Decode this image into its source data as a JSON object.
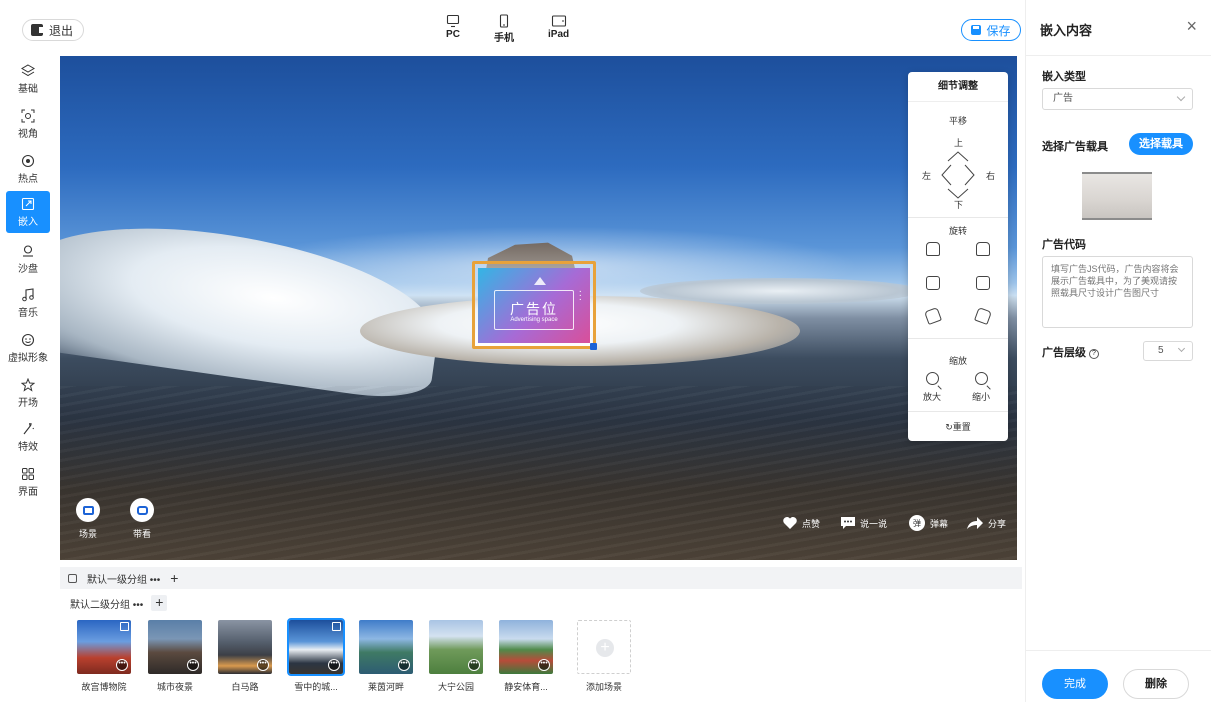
{
  "topbar": {
    "exit_label": "退出",
    "devices": [
      {
        "label": "PC",
        "icon": "monitor-icon"
      },
      {
        "label": "手机",
        "icon": "phone-icon"
      },
      {
        "label": "iPad",
        "icon": "tablet-icon"
      }
    ],
    "save_label": "保存"
  },
  "sidebar": {
    "items": [
      {
        "label": "基础",
        "icon": "layers-icon"
      },
      {
        "label": "视角",
        "icon": "eye-icon"
      },
      {
        "label": "热点",
        "icon": "target-icon"
      },
      {
        "label": "嵌入",
        "icon": "embed-icon"
      },
      {
        "label": "沙盘",
        "icon": "map-pin-icon"
      },
      {
        "label": "音乐",
        "icon": "music-icon"
      },
      {
        "label": "虚拟形象",
        "icon": "avatar-icon"
      },
      {
        "label": "开场",
        "icon": "star-icon"
      },
      {
        "label": "特效",
        "icon": "magic-wand-icon"
      },
      {
        "label": "界面",
        "icon": "grid-icon"
      }
    ],
    "active_index": 3
  },
  "viewer": {
    "ad": {
      "title": "广告位",
      "subtitle": "Advertising space"
    },
    "detail_panel": {
      "title": "细节调整",
      "pan": {
        "label": "平移",
        "up": "上",
        "down": "下",
        "left": "左",
        "right": "右"
      },
      "rotate": {
        "label": "旋转"
      },
      "zoom": {
        "label": "缩放",
        "in": "放大",
        "out": "缩小"
      },
      "reset": "重置"
    },
    "bottom_left": [
      {
        "label": "场景",
        "icon": "scene-icon"
      },
      {
        "label": "带看",
        "icon": "guide-icon"
      }
    ],
    "social": [
      {
        "label": "点赞",
        "icon": "heart-icon"
      },
      {
        "label": "说一说",
        "icon": "comment-icon"
      },
      {
        "label": "弹幕",
        "icon": "danmaku-icon"
      },
      {
        "label": "分享",
        "icon": "share-icon"
      }
    ]
  },
  "scenes": {
    "group1_label": "默认一级分组 •••",
    "group2_label": "默认二级分组 •••",
    "items": [
      {
        "name": "故宫博物院",
        "selected": false
      },
      {
        "name": "城市夜景",
        "selected": false
      },
      {
        "name": "白马路",
        "selected": false
      },
      {
        "name": "雪中的城...",
        "selected": true
      },
      {
        "name": "莱茵河畔",
        "selected": false
      },
      {
        "name": "大宁公园",
        "selected": false
      },
      {
        "name": "静安体育...",
        "selected": false
      }
    ],
    "add_label": "添加场景"
  },
  "right_panel": {
    "title": "嵌入内容",
    "embed_type_label": "嵌入类型",
    "embed_type_value": "广告",
    "carrier_label": "选择广告载具",
    "carrier_button": "选择载具",
    "code_label": "广告代码",
    "code_placeholder": "填写广告JS代码，广告内容将会展示广告载具中，为了美观请按照载具尺寸设计广告图尺寸",
    "level_label": "广告层级",
    "level_value": "5",
    "done_button": "完成",
    "delete_button": "删除"
  }
}
